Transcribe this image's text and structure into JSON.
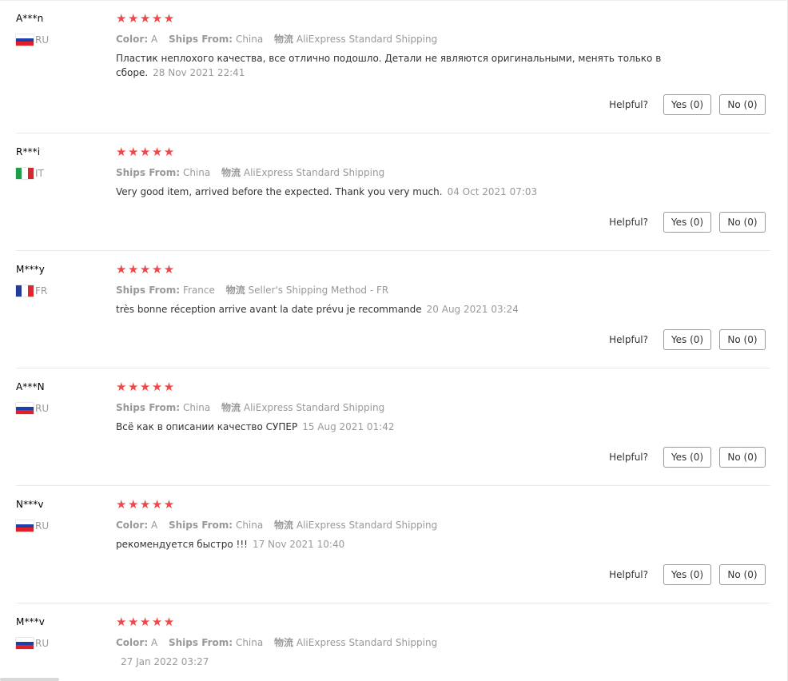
{
  "helpful_label": "Helpful?",
  "reviews": [
    {
      "user": "A***n",
      "country": "RU",
      "color_label": "Color:",
      "color_value": "A",
      "ships_from_label": "Ships From:",
      "ships_from_value": "China",
      "logistics_label": "物流",
      "logistics_value": "AliExpress Standard Shipping",
      "text": "Пластик неплохого качества, все отлично подошло. Детали не являются оригинальными, менять только в сборе.",
      "date": "28 Nov 2021 22:41",
      "yes": "Yes (0)",
      "no": "No (0)"
    },
    {
      "user": "R***i",
      "country": "IT",
      "ships_from_label": "Ships From:",
      "ships_from_value": "China",
      "logistics_label": "物流",
      "logistics_value": "AliExpress Standard Shipping",
      "text": "Very good item, arrived before the expected. Thank you very much.",
      "date": "04 Oct 2021 07:03",
      "yes": "Yes (0)",
      "no": "No (0)"
    },
    {
      "user": "M***y",
      "country": "FR",
      "ships_from_label": "Ships From:",
      "ships_from_value": "France",
      "logistics_label": "物流",
      "logistics_value": "Seller's Shipping Method - FR",
      "text": "très bonne réception arrive avant la date prévu je recommande",
      "date": "20 Aug 2021 03:24",
      "yes": "Yes (0)",
      "no": "No (0)"
    },
    {
      "user": "A***N",
      "country": "RU",
      "ships_from_label": "Ships From:",
      "ships_from_value": "China",
      "logistics_label": "物流",
      "logistics_value": "AliExpress Standard Shipping",
      "text": "Всё как в описании качество СУПЕР",
      "date": "15 Aug 2021 01:42",
      "yes": "Yes (0)",
      "no": "No (0)"
    },
    {
      "user": "N***v",
      "country": "RU",
      "color_label": "Color:",
      "color_value": "A",
      "ships_from_label": "Ships From:",
      "ships_from_value": "China",
      "logistics_label": "物流",
      "logistics_value": "AliExpress Standard Shipping",
      "text": "рекомендуется быстро !!!",
      "date": "17 Nov 2021 10:40",
      "yes": "Yes (0)",
      "no": "No (0)"
    },
    {
      "user": "M***v",
      "country": "RU",
      "color_label": "Color:",
      "color_value": "A",
      "ships_from_label": "Ships From:",
      "ships_from_value": "China",
      "logistics_label": "物流",
      "logistics_value": "AliExpress Standard Shipping",
      "text": "",
      "date": "27 Jan 2022 03:27"
    }
  ],
  "rating_stars": "★★★★★",
  "colors": {
    "star": "#f0484a",
    "muted": "#999999",
    "text": "#333333"
  },
  "flags": {
    "RU": [
      "#ffffff",
      "#1c3fa8",
      "#e41e26"
    ],
    "IT": [
      "#1f9e49",
      "#ffffff",
      "#d8262e"
    ],
    "FR": [
      "#223c99",
      "#ffffff",
      "#e2262c"
    ]
  },
  "icons": {
    "flag": "country-flag-icon",
    "star": "star-icon"
  }
}
